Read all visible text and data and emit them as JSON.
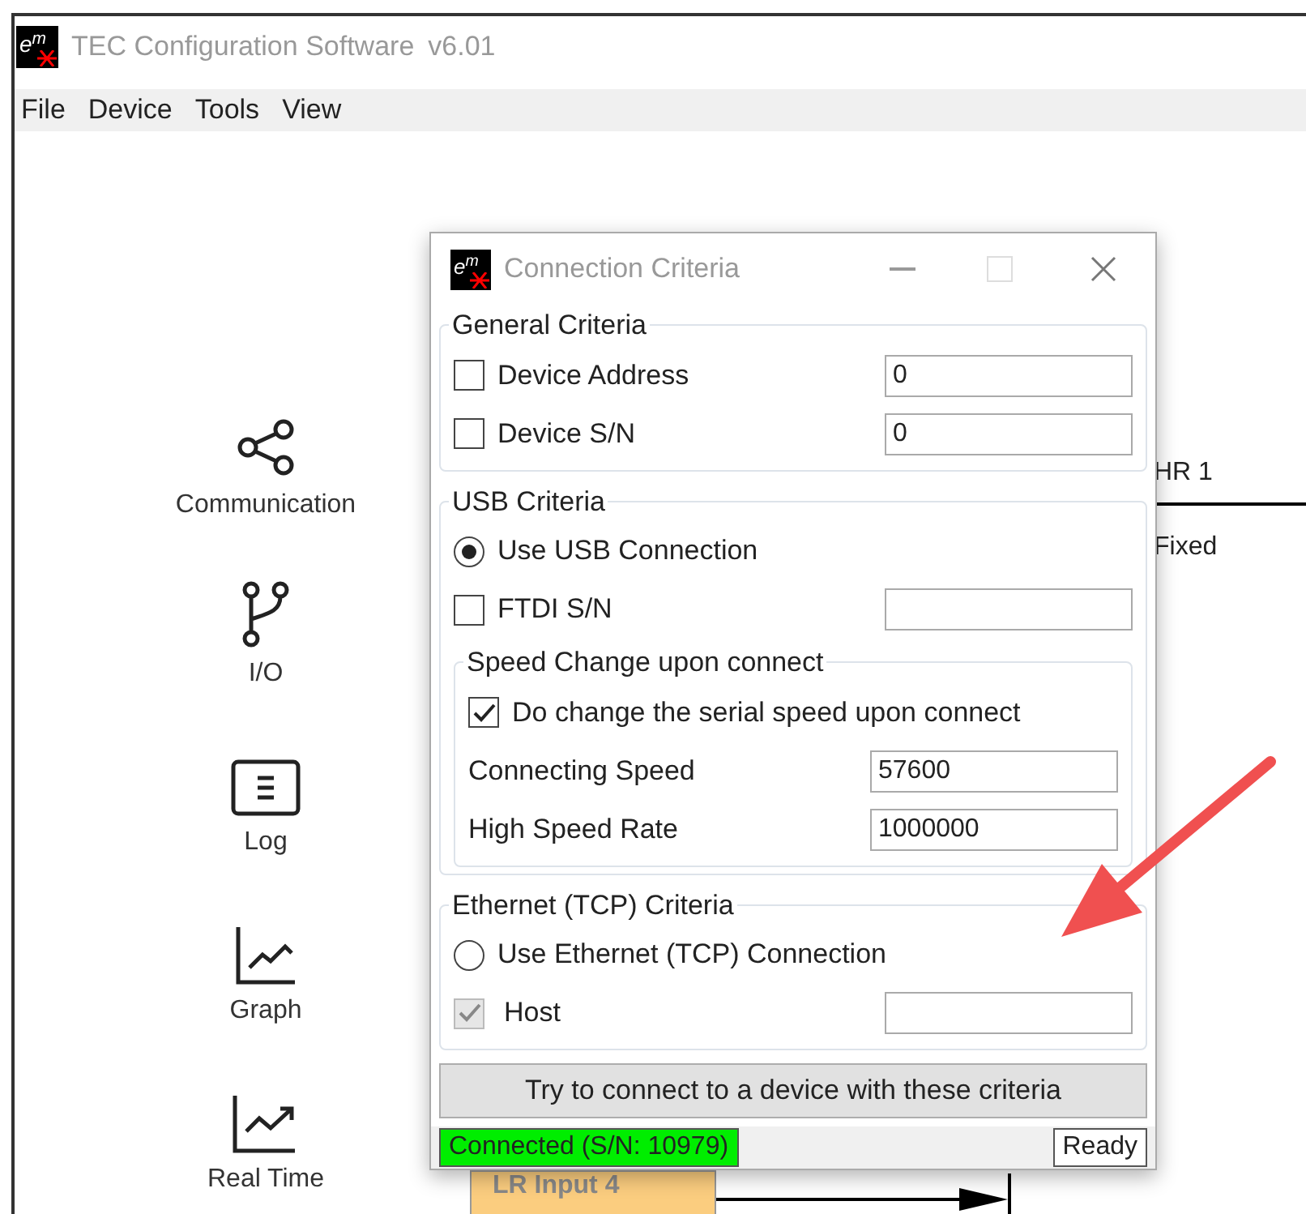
{
  "window": {
    "logo_text": "e$^{m}$",
    "title": "TEC Configuration Software",
    "version": "v6.01"
  },
  "menu": [
    {
      "label": "File"
    },
    {
      "label": "Device"
    },
    {
      "label": "Tools"
    },
    {
      "label": "View"
    }
  ],
  "sidebar": {
    "items": [
      {
        "label": "Communication",
        "kind": "share"
      },
      {
        "label": "I/O",
        "kind": "branch"
      },
      {
        "label": "Log",
        "kind": "log"
      },
      {
        "label": "Graph",
        "kind": "graph"
      },
      {
        "label": "Real Time",
        "kind": "trend"
      }
    ]
  },
  "canvas": {
    "header": "HR 1",
    "cell": "Fixed",
    "block": "LR Input 4"
  },
  "dialog": {
    "logo_text": "e$^{m}$",
    "title": "Connection Criteria",
    "groups": [
      {
        "legend": "General Criteria",
        "rows": [
          {
            "kind": "checkbox",
            "label": "Device Address",
            "checked": false,
            "disabled": false,
            "value": "0"
          },
          {
            "kind": "checkbox",
            "label": "Device S/N",
            "checked": false,
            "disabled": false,
            "value": "0"
          }
        ]
      },
      {
        "legend": "USB Criteria",
        "rows": [
          {
            "kind": "radio",
            "label": "Use USB Connection",
            "selected": true
          },
          {
            "kind": "checkbox",
            "label": "FTDI S/N",
            "checked": false,
            "disabled": false,
            "value": ""
          }
        ],
        "subgroup": {
          "legend": "Speed Change upon connect",
          "rows": [
            {
              "kind": "checkbox",
              "label": "Do change the serial speed upon connect",
              "checked": true,
              "disabled": false
            },
            {
              "kind": "field",
              "label": "Connecting Speed",
              "value": "57600"
            },
            {
              "kind": "field",
              "label": "High Speed Rate",
              "value": "1000000"
            }
          ]
        }
      },
      {
        "legend": "Ethernet (TCP) Criteria",
        "rows": [
          {
            "kind": "radio",
            "label": "Use Ethernet (TCP) Connection",
            "selected": false
          },
          {
            "kind": "checkbox",
            "label": "Host",
            "checked": true,
            "disabled": true,
            "value": ""
          }
        ]
      }
    ],
    "button": "Try to connect to a device with these criteria",
    "status_bar": {
      "connection": "Connected (S/N: 10979)",
      "connected": true,
      "state": "Ready"
    }
  }
}
